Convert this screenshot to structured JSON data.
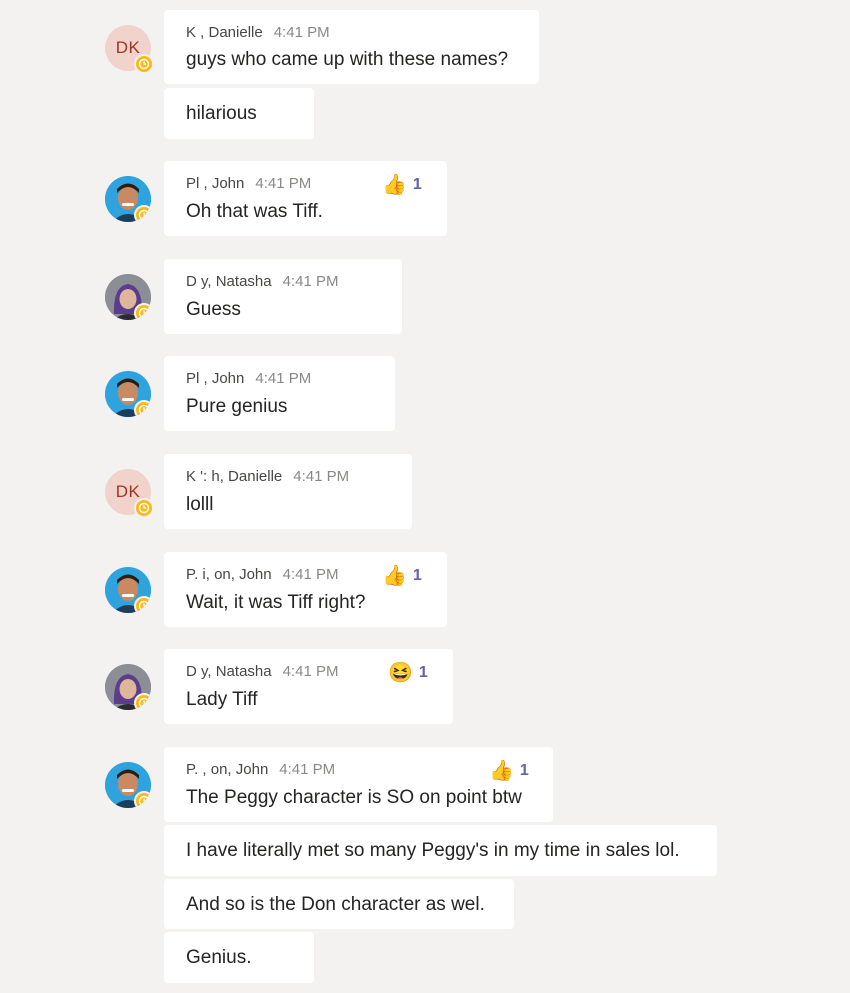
{
  "messages": [
    {
      "author": "K        , Danielle",
      "time": "4:41 PM",
      "text": "guys who came up with these names?",
      "avatar_initials": "DK"
    },
    {
      "text": "hilarious"
    },
    {
      "author": "Pl           , John",
      "time": "4:41 PM",
      "text": "Oh that was Tiff.",
      "reaction_count": "1",
      "reaction_icon": "thumbs-up-icon"
    },
    {
      "author": "D        y, Natasha",
      "time": "4:41 PM",
      "text": "Guess"
    },
    {
      "author": "Pl           , John",
      "time": "4:41 PM",
      "text": "Pure genius"
    },
    {
      "author": "K    ':  h, Danielle",
      "time": "4:41 PM",
      "text": "lolll",
      "avatar_initials": "DK"
    },
    {
      "author": "P.   i,     on, John",
      "time": "4:41 PM",
      "text": "Wait, it was Tiff right?",
      "reaction_count": "1",
      "reaction_icon": "thumbs-up-icon"
    },
    {
      "author": "D       y, Natasha",
      "time": "4:41 PM",
      "text": "Lady Tiff",
      "reaction_count": "1",
      "reaction_icon": "laughing-face-icon"
    },
    {
      "author": "P.    ,     on, John",
      "time": "4:41 PM",
      "text": "The Peggy character is SO on point btw",
      "reaction_count": "1",
      "reaction_icon": "thumbs-up-icon"
    },
    {
      "text": "I have literally met so many Peggy's in my time in sales lol."
    },
    {
      "text": "And so is the Don character as wel."
    },
    {
      "text": "Genius."
    }
  ],
  "colors": {
    "background": "#f3f2f1",
    "bubble": "#ffffff",
    "presence_away": "#fdb913",
    "reaction_count": "#6264a7"
  }
}
